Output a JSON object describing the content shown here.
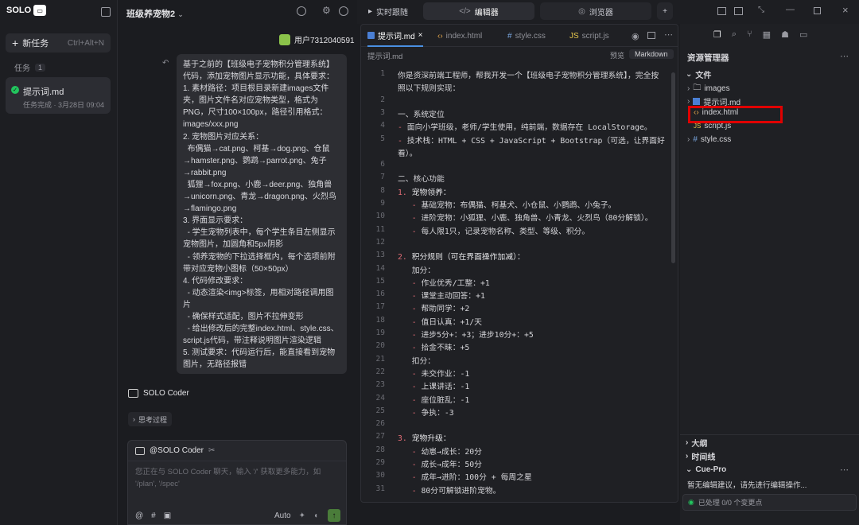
{
  "logo": {
    "text": "SOLO"
  },
  "sidebar": {
    "new_task": "新任务",
    "shortcut": "Ctrl+Alt+N",
    "tasks_label": "任务",
    "tasks_count": "1",
    "task": {
      "title": "提示词.md",
      "status": "任务完成 · 3月28日 09:04"
    }
  },
  "chat": {
    "title": "班级养宠物2",
    "user": "用户7312040591",
    "message": "基于之前的【班级电子宠物积分管理系统】代码，添加宠物图片显示功能，具体要求：\n1. 素材路径：项目根目录新建images文件夹，图片文件名对应宠物类型，格式为PNG，尺寸100×100px，路径引用格式：images/xxx.png\n2. 宠物图片对应关系：\n  布偶猫→cat.png、柯基→dog.png、仓鼠→hamster.png、鹦鹉→parrot.png、兔子→rabbit.png\n  狐狸→fox.png、小鹿→deer.png、独角兽→unicorn.png、青龙→dragon.png、火烈鸟→flamingo.png\n3. 界面显示要求：\n  - 学生宠物列表中，每个学生条目左侧显示宠物图片，加圆角和5px阴影\n  - 领养宠物的下拉选择框内，每个选项前附带对应宠物小图标（50×50px）\n4. 代码修改要求：\n  - 动态渲染<img>标签，用相对路径调用图片\n  - 确保样式适配，图片不拉伸变形\n  - 给出修改后的完整index.html、style.css、script.js代码，带注释说明图片渲染逻辑\n5. 测试要求：代码运行后，能直接看到宠物图片，无路径报错",
    "coder_label": "SOLO Coder",
    "thinking": "思考过程",
    "input_header": "@SOLO Coder",
    "placeholder": "您正在与 SOLO Coder 聊天，输入 '/' 获取更多能力，如 '/plan', '/spec'",
    "mode": "Auto"
  },
  "topbar": {
    "tab1": "实时跟随",
    "tab2": "编辑器",
    "tab3": "浏览器"
  },
  "editor": {
    "tabs": [
      "提示词.md",
      "index.html",
      "style.css",
      "script.js"
    ],
    "crumb": "提示词.md",
    "preview": "预览",
    "markdown": "Markdown",
    "lines": [
      [
        "1",
        "你是资深前端工程师，帮我开发一个【班级电子宠物积分管理系统】，完全按"
      ],
      [
        "",
        "照以下规则实现："
      ],
      [
        "2",
        ""
      ],
      [
        "3",
        "一、系统定位"
      ],
      [
        "4",
        "- 面向小学班级，老师/学生使用，纯前端，数据存在 LocalStorage。"
      ],
      [
        "5",
        "- 技术栈：HTML + CSS + JavaScript + Bootstrap（可选，让界面好"
      ],
      [
        "",
        "看）。"
      ],
      [
        "6",
        ""
      ],
      [
        "7",
        "二、核心功能"
      ],
      [
        "8",
        "1. 宠物领养："
      ],
      [
        "9",
        "   - 基础宠物：布偶猫、柯基犬、小仓鼠、小鹦鹉、小兔子。"
      ],
      [
        "10",
        "   - 进阶宠物：小狐狸、小鹿、独角兽、小青龙、火烈鸟（80分解锁）。"
      ],
      [
        "11",
        "   - 每人限1只，记录宠物名称、类型、等级、积分。"
      ],
      [
        "12",
        ""
      ],
      [
        "13",
        "2. 积分规则（可在界面操作加减）："
      ],
      [
        "14",
        "   加分："
      ],
      [
        "15",
        "   - 作业优秀/工整：+1"
      ],
      [
        "16",
        "   - 课堂主动回答：+1"
      ],
      [
        "17",
        "   - 帮助同学：+2"
      ],
      [
        "18",
        "   - 值日认真：+1/天"
      ],
      [
        "19",
        "   - 进步5分+：+3；进步10分+：+5"
      ],
      [
        "20",
        "   - 拾金不昧：+5"
      ],
      [
        "21",
        "   扣分："
      ],
      [
        "22",
        "   - 未交作业：-1"
      ],
      [
        "23",
        "   - 上课讲话：-1"
      ],
      [
        "24",
        "   - 座位脏乱：-1"
      ],
      [
        "25",
        "   - 争执：-3"
      ],
      [
        "26",
        ""
      ],
      [
        "27",
        "3. 宠物升级："
      ],
      [
        "28",
        "   - 幼崽→成长：20分"
      ],
      [
        "29",
        "   - 成长→成年：50分"
      ],
      [
        "30",
        "   - 成年→进阶：100分 + 每周之星"
      ],
      [
        "31",
        "   - 80分可解锁进阶宠物。"
      ]
    ]
  },
  "explorer": {
    "title": "资源管理器",
    "files_label": "文件",
    "items": [
      "images",
      "提示词.md",
      "index.html",
      "script.js",
      "style.css"
    ],
    "outline": "大纲",
    "timeline": "时间线",
    "cue": "Cue-Pro",
    "cue_msg": "暂无编辑建议，请先进行编辑操作...",
    "processed": "已处理 0/0 个变更点"
  }
}
